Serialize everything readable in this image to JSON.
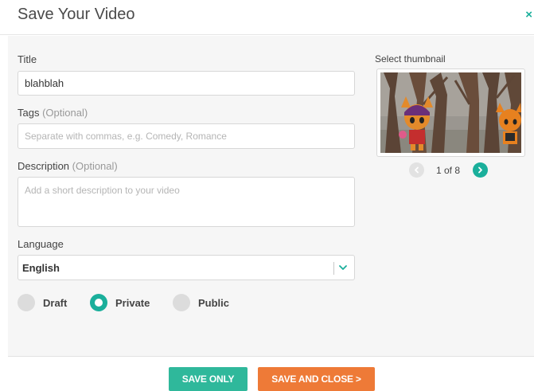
{
  "dialog": {
    "title": "Save Your Video",
    "close_icon": "×"
  },
  "form": {
    "title_label": "Title",
    "title_value": "blahblah",
    "tags_label": "Tags",
    "tags_optional": "(Optional)",
    "tags_placeholder": "Separate with commas, e.g. Comedy, Romance",
    "description_label": "Description",
    "description_optional": "(Optional)",
    "description_placeholder": "Add a short description to your video",
    "language_label": "Language",
    "language_value": "English",
    "privacy_options": [
      {
        "label": "Draft",
        "checked": false
      },
      {
        "label": "Private",
        "checked": true
      },
      {
        "label": "Public",
        "checked": false
      }
    ]
  },
  "thumbnail": {
    "label": "Select thumbnail",
    "pager_text": "1 of 8",
    "prev_icon": "chevron-left-icon",
    "next_icon": "chevron-right-icon"
  },
  "footer": {
    "save_only_label": "SAVE ONLY",
    "save_close_label": "SAVE AND CLOSE >"
  },
  "colors": {
    "accent": "#1aaf9b",
    "save_only": "#2fb89b",
    "save_close": "#ee7a37"
  }
}
